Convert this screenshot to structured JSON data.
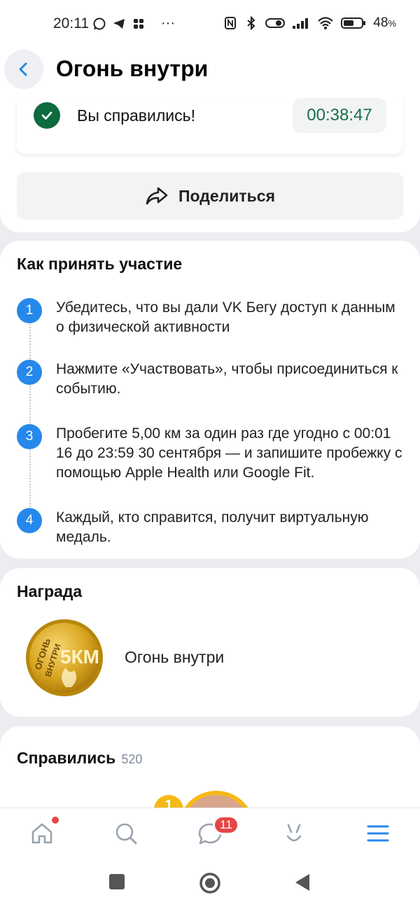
{
  "status_bar": {
    "time": "20:11",
    "more": "···",
    "battery": "48",
    "battery_unit": "%"
  },
  "header": {
    "title": "Огонь внутри"
  },
  "completion": {
    "message": "Вы справились!",
    "duration": "00:38:47"
  },
  "share": {
    "label": "Поделиться"
  },
  "how_to": {
    "title": "Как принять участие",
    "steps": [
      {
        "num": "1",
        "text": "Убедитесь, что вы дали VK Бегу доступ к данным о физической активности"
      },
      {
        "num": "2",
        "text": "Нажмите «Участвовать», чтобы присоединиться к событию."
      },
      {
        "num": "3",
        "text": "Пробегите 5,00 км за один раз где угодно с 00:01 16 до 23:59 30 сентября — и запишите пробежку с помощью Apple Health или Google Fit."
      },
      {
        "num": "4",
        "text": "Каждый, кто справится, получит виртуальную медаль."
      }
    ]
  },
  "reward": {
    "title": "Награда",
    "name": "Огонь внутри",
    "medal_text_top": "ОГОНЬ",
    "medal_text_bottom": "ВНУТРИ",
    "medal_distance": "5КМ"
  },
  "completed": {
    "title": "Справились",
    "count": "520",
    "first_rank": "1"
  },
  "tabbar": {
    "messages_badge": "11",
    "icons": [
      "home-icon",
      "search-icon",
      "messages-icon",
      "services-icon",
      "menu-icon"
    ]
  },
  "colors": {
    "accent": "#2688eb",
    "success": "#0d6b3d",
    "duration_text": "#1b6f47",
    "badge": "#e64646",
    "gold": "#f5b917"
  }
}
